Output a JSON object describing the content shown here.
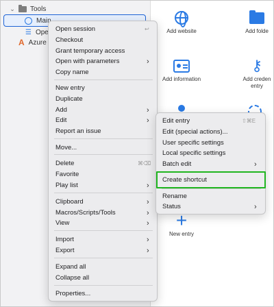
{
  "sidebar": {
    "items": [
      {
        "label": "Tools"
      },
      {
        "label": "Main"
      },
      {
        "label": "Ope"
      },
      {
        "label": "Azure"
      }
    ]
  },
  "panel": {
    "tiles": [
      {
        "label": "Add website",
        "icon": "globe-icon"
      },
      {
        "label": "Add folde",
        "icon": "folder-icon"
      },
      {
        "label": "Add information",
        "icon": "contact-card-icon"
      },
      {
        "label": "Add creden\nentry",
        "icon": "key-icon"
      },
      {
        "label": "New entry",
        "icon": "plus-icon"
      }
    ]
  },
  "context_menu": {
    "items": [
      {
        "label": "Open session",
        "shortcut": "↩"
      },
      {
        "label": "Checkout"
      },
      {
        "label": "Grant temporary access"
      },
      {
        "label": "Open with parameters",
        "submenu": true
      },
      {
        "label": "Copy name"
      },
      {
        "label": "New entry"
      },
      {
        "label": "Duplicate"
      },
      {
        "label": "Add",
        "submenu": true
      },
      {
        "label": "Edit",
        "submenu": true
      },
      {
        "label": "Report an issue"
      },
      {
        "label": "Move..."
      },
      {
        "label": "Delete",
        "shortcut": "⌘⌫"
      },
      {
        "label": "Favorite"
      },
      {
        "label": "Play list",
        "submenu": true
      },
      {
        "label": "Clipboard",
        "submenu": true
      },
      {
        "label": "Macros/Scripts/Tools",
        "submenu": true
      },
      {
        "label": "View",
        "submenu": true
      },
      {
        "label": "Import",
        "submenu": true
      },
      {
        "label": "Export",
        "submenu": true
      },
      {
        "label": "Expand all"
      },
      {
        "label": "Collapse all"
      },
      {
        "label": "Properties..."
      }
    ]
  },
  "edit_submenu": {
    "items": [
      {
        "label": "Edit entry",
        "shortcut": "⇧⌘E"
      },
      {
        "label": "Edit (special actions)..."
      },
      {
        "label": "User specific settings"
      },
      {
        "label": "Local specific settings"
      },
      {
        "label": "Batch edit",
        "submenu": true
      },
      {
        "label": "Create shortcut"
      },
      {
        "label": "Rename"
      },
      {
        "label": "Status",
        "submenu": true
      }
    ]
  },
  "colors": {
    "accent": "#2a7ae4",
    "selection_border": "#1d62d5",
    "highlight_box": "#1fb51f"
  }
}
